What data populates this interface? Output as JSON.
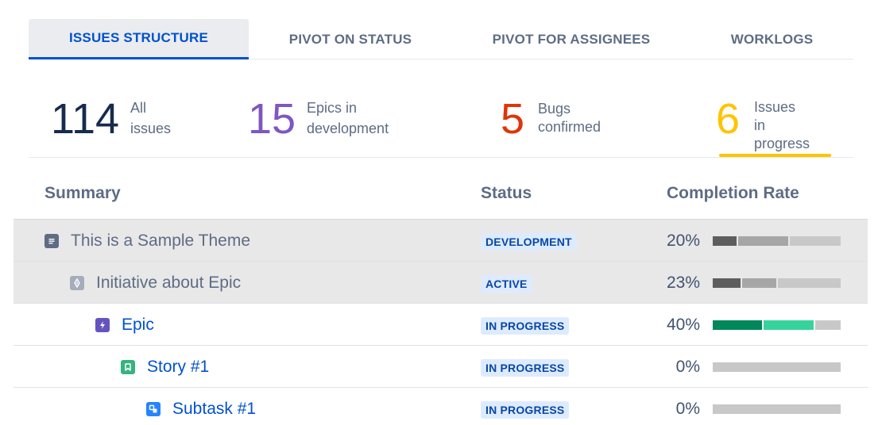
{
  "tabs": [
    {
      "label": "ISSUES STRUCTURE",
      "active": true
    },
    {
      "label": "PIVOT ON STATUS",
      "active": false
    },
    {
      "label": "PIVOT FOR ASSIGNEES",
      "active": false
    },
    {
      "label": "WORKLOGS",
      "active": false
    }
  ],
  "stats": [
    {
      "value": "114",
      "line1": "All",
      "line2": "issues",
      "color": "#172b4d"
    },
    {
      "value": "15",
      "line1": "Epics in",
      "line2": "development",
      "color": "#7e57c2"
    },
    {
      "value": "5",
      "line1": "Bugs",
      "line2": "confirmed",
      "color": "#de350b"
    },
    {
      "value": "6",
      "line1": "Issues",
      "line2": "in progress",
      "color": "#ffc400"
    }
  ],
  "table": {
    "headers": {
      "summary": "Summary",
      "status": "Status",
      "completion": "Completion Rate"
    },
    "rows": [
      {
        "name": "This is a Sample Theme",
        "icon": "theme-icon",
        "status": "DEVELOPMENT",
        "percent": "20%",
        "progress": 0.2,
        "bar": [
          {
            "fraction": 0.2,
            "color": "#5e5e5e"
          },
          {
            "fraction": 0.4,
            "color": "#a6a6a6"
          },
          {
            "fraction": 0.4,
            "color": "#c8c8c8"
          }
        ]
      },
      {
        "name": "Initiative about Epic",
        "icon": "initiative-icon",
        "status": "ACTIVE",
        "percent": "23%",
        "progress": 0.23,
        "bar": [
          {
            "fraction": 0.23,
            "color": "#5e5e5e"
          },
          {
            "fraction": 0.28,
            "color": "#a6a6a6"
          },
          {
            "fraction": 0.49,
            "color": "#c8c8c8"
          }
        ]
      },
      {
        "name": "Epic",
        "icon": "epic-icon",
        "status": "IN PROGRESS",
        "percent": "40%",
        "progress": 0.4,
        "bar": [
          {
            "fraction": 0.4,
            "color": "#00875a"
          },
          {
            "fraction": 0.4,
            "color": "#36d49c"
          },
          {
            "fraction": 0.2,
            "color": "#c8c8c8"
          }
        ]
      },
      {
        "name": "Story #1",
        "icon": "story-icon",
        "status": "IN PROGRESS",
        "percent": "0%",
        "progress": 0.0,
        "bar": [
          {
            "fraction": 1.0,
            "color": "#c8c8c8"
          }
        ]
      },
      {
        "name": "Subtask #1",
        "icon": "subtask-icon",
        "status": "IN PROGRESS",
        "percent": "0%",
        "progress": 0.0,
        "bar": [
          {
            "fraction": 1.0,
            "color": "#c8c8c8"
          }
        ]
      }
    ]
  }
}
